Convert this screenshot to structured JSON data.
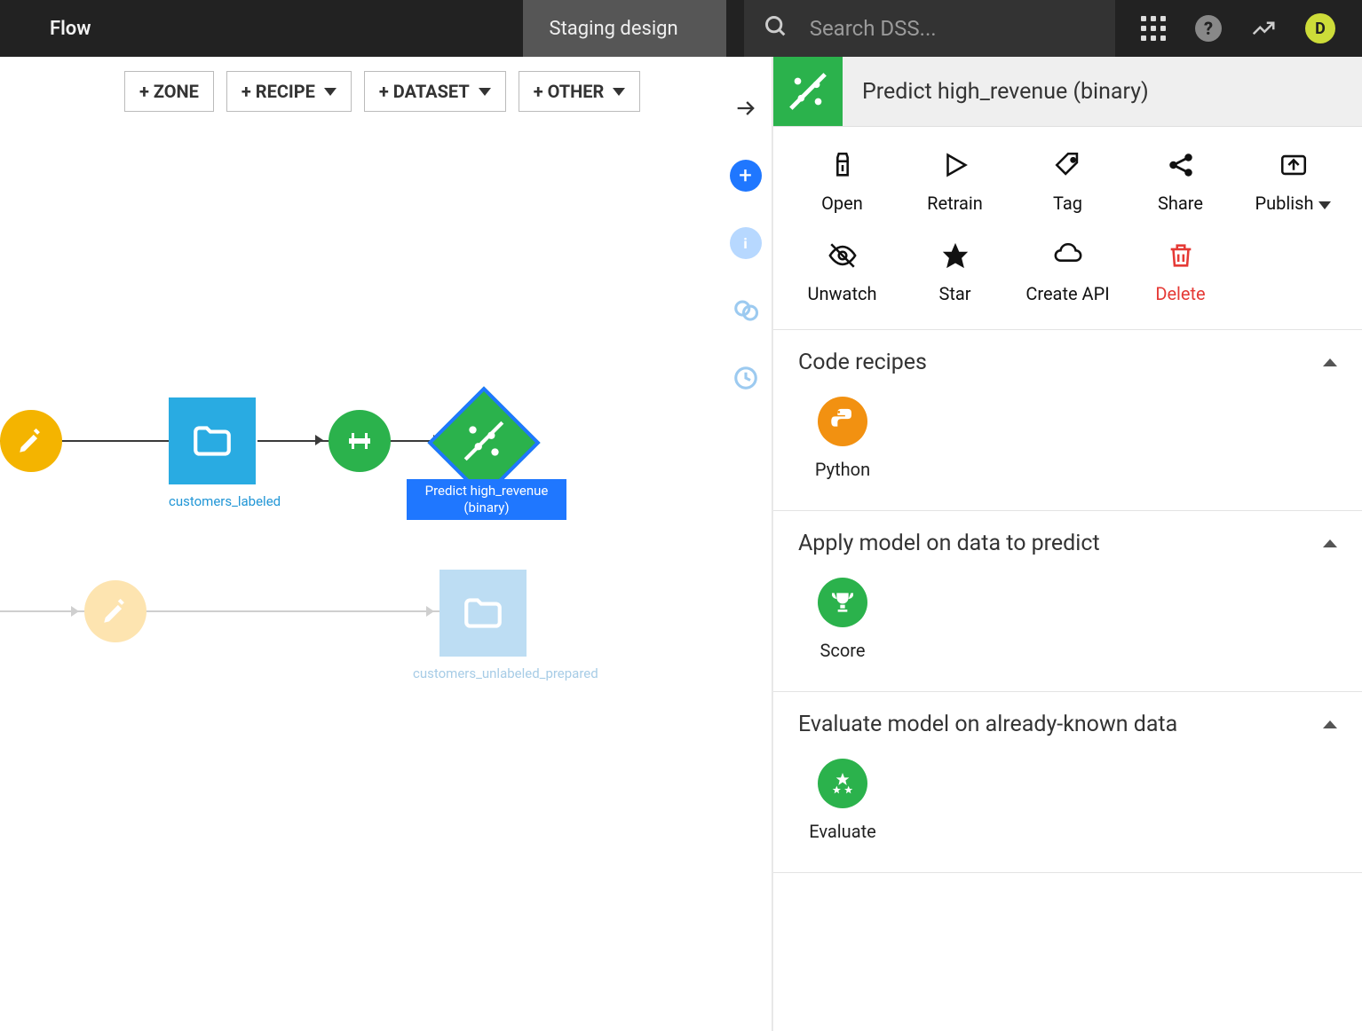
{
  "header": {
    "flow_tab": "Flow",
    "staging_tab": "Staging design",
    "search_placeholder": "Search DSS...",
    "avatar_letter": "D"
  },
  "toolbar": {
    "zone": "+ ZONE",
    "recipe": "+ RECIPE",
    "dataset": "+ DATASET",
    "other": "+ OTHER"
  },
  "canvas": {
    "dataset_labeled": "customers_labeled",
    "dataset_unlabeled": "customers_unlabeled_prepared",
    "model_label": "Predict high_revenue (binary)"
  },
  "panel": {
    "title": "Predict high_revenue (binary)",
    "actions": {
      "open": "Open",
      "retrain": "Retrain",
      "tag": "Tag",
      "share": "Share",
      "publish": "Publish",
      "unwatch": "Unwatch",
      "star": "Star",
      "create_api": "Create API",
      "delete": "Delete"
    },
    "sections": {
      "code_recipes": {
        "title": "Code recipes",
        "items": {
          "python": "Python"
        }
      },
      "apply_model": {
        "title": "Apply model on data to predict",
        "items": {
          "score": "Score"
        }
      },
      "evaluate": {
        "title": "Evaluate model on already-known data",
        "items": {
          "evaluate": "Evaluate"
        }
      }
    }
  }
}
